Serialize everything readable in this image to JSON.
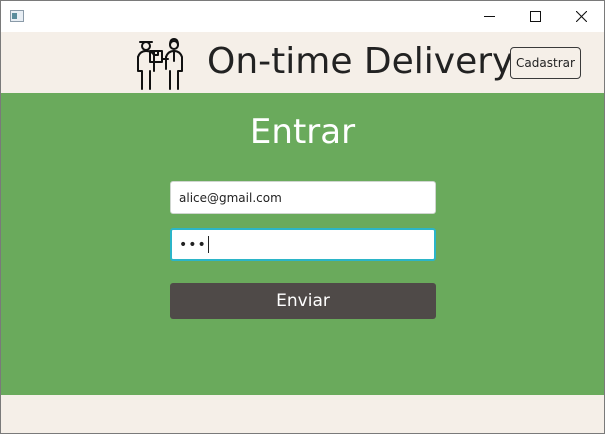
{
  "window": {
    "minimize_icon": "minimize-icon",
    "maximize_icon": "maximize-icon",
    "close_icon": "close-icon"
  },
  "header": {
    "title": "On-time Delivery",
    "register_label": "Cadastrar",
    "logo_icon": "delivery-people-icon"
  },
  "login": {
    "title": "Entrar",
    "email_value": "alice@gmail.com",
    "password_mask": "•••",
    "submit_label": "Enviar"
  },
  "colors": {
    "main_background": "#6aaa5c",
    "header_background": "#f5efe8",
    "submit_button": "#4f4a48",
    "focus_border": "#2bb5c8"
  }
}
